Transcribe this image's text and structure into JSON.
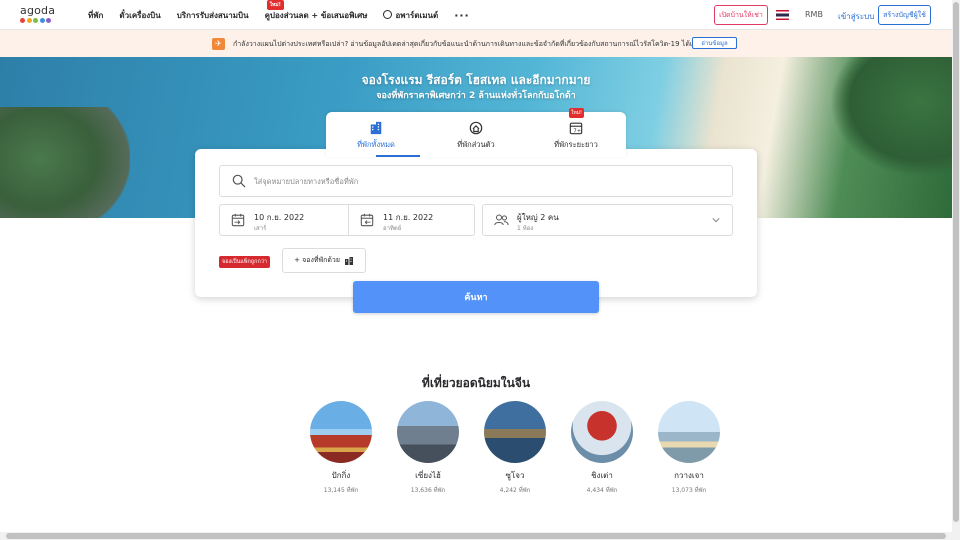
{
  "header": {
    "logo": "agoda",
    "logo_colors": [
      "#e8423a",
      "#f5a623",
      "#7bc043",
      "#3f8fe0",
      "#8b5fc7"
    ],
    "nav": [
      {
        "label": "ที่พัก"
      },
      {
        "label": "ตั๋วเครื่องบิน"
      },
      {
        "label": "บริการรับส่งสนามบิน"
      },
      {
        "label": "คูปองส่วนลด + ข้อเสนอพิเศษ",
        "badge": "ใหม่!"
      },
      {
        "label": "อพาร์ตเมนต์"
      },
      {
        "label": "···"
      }
    ],
    "list_property": "เปิดบ้านให้เช่า",
    "currency": "RMB",
    "login": "เข้าสู่ระบบ",
    "signup": "สร้างบัญชีผู้ใช้"
  },
  "banner": {
    "text": "กำลังวางแผนไปต่างประเทศหรือเปล่า? อ่านข้อมูลอัปเดตล่าสุดเกี่ยวกับข้อแนะนำด้านการเดินทางและข้อจำกัดที่เกี่ยวข้องกับสถานการณ์ไวรัสโควิด-19 ได้เลย",
    "button": "อ่านข้อมูล"
  },
  "hero": {
    "title": "จองโรงแรม รีสอร์ต โฮสเทล และอีกมากมาย",
    "subtitle": "จองที่พักราคาพิเศษกว่า 2 ล้านแห่งทั่วโลกกับอโกด้า"
  },
  "tabs": [
    {
      "label": "ที่พักทั้งหมด",
      "icon": "building-icon",
      "active": true
    },
    {
      "label": "ที่พักส่วนตัว",
      "icon": "house-icon"
    },
    {
      "label": "ที่พักระยะยาว",
      "icon": "calendar-icon",
      "badge": "ใหม่!"
    }
  ],
  "search": {
    "placeholder": "ใส่จุดหมายปลายทางหรือชื่อที่พัก",
    "checkin": {
      "date": "10 ก.ย. 2022",
      "day": "เสาร์"
    },
    "checkout": {
      "date": "11 ก.ย. 2022",
      "day": "อาทิตย์"
    },
    "guests": {
      "main": "ผู้ใหญ่ 2 คน",
      "sub": "1 ห้อง"
    },
    "deal_badge": "จองเป็นแพ็กถูกกว่า",
    "add_flight": "+ จองที่พักด้วย",
    "button": "ค้นหา"
  },
  "destinations": {
    "title": "ที่เที่ยวยอดนิยมในจีน",
    "items": [
      {
        "name": "ปักกิ่ง",
        "count": "13,145 ที่พัก"
      },
      {
        "name": "เซี่ยงไฮ้",
        "count": "13,636 ที่พัก"
      },
      {
        "name": "ซูโจว",
        "count": "4,242 ที่พัก"
      },
      {
        "name": "ชิงเต่า",
        "count": "4,434 ที่พัก"
      },
      {
        "name": "กวางเจา",
        "count": "13,073 ที่พัก"
      }
    ]
  },
  "colors": {
    "primary": "#2a6fd6",
    "search_button": "#5392f9",
    "brand_pink": "#e03a63",
    "badge_red": "#e12d2d"
  }
}
